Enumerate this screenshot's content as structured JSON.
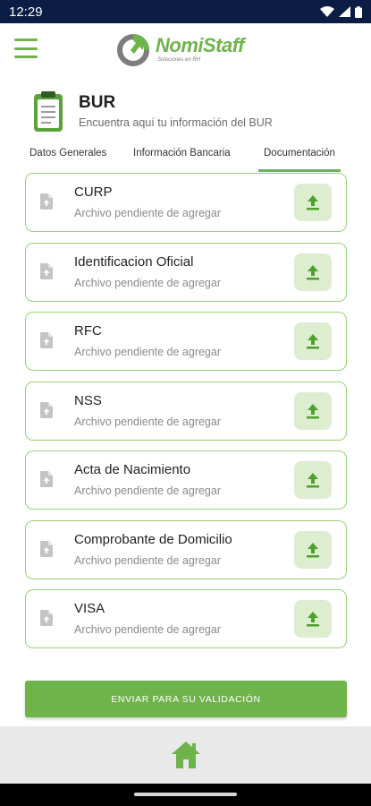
{
  "status_bar": {
    "time": "12:29"
  },
  "header": {
    "logo_name": "NomiStaff",
    "logo_tagline": "Soluciones en RH"
  },
  "section": {
    "title": "BUR",
    "subtitle": "Encuentra aquí tu información del BUR"
  },
  "tabs": [
    {
      "label": "Datos Generales",
      "active": false
    },
    {
      "label": "Información Bancaria",
      "active": false
    },
    {
      "label": "Documentación",
      "active": true
    }
  ],
  "documents": [
    {
      "name": "CURP",
      "status": "Archivo pendiente de agregar"
    },
    {
      "name": "Identificacion Oficial",
      "status": "Archivo pendiente de agregar"
    },
    {
      "name": "RFC",
      "status": "Archivo pendiente de agregar"
    },
    {
      "name": "NSS",
      "status": "Archivo pendiente de agregar"
    },
    {
      "name": "Acta de Nacimiento",
      "status": "Archivo pendiente de agregar"
    },
    {
      "name": "Comprobante de Domicilio",
      "status": "Archivo pendiente de agregar"
    },
    {
      "name": "VISA",
      "status": "Archivo pendiente de agregar"
    }
  ],
  "submit_label": "ENVIAR PARA SU VALIDACIÓN",
  "icons": {
    "menu": "hamburger-icon",
    "section": "clipboard-icon",
    "file": "file-upload-icon",
    "upload": "upload-icon",
    "home": "home-icon"
  },
  "colors": {
    "accent": "#6fb34b",
    "status_bar": "#0b1d44",
    "upload_bg": "#dcedd0",
    "card_border": "#9ad07a"
  }
}
